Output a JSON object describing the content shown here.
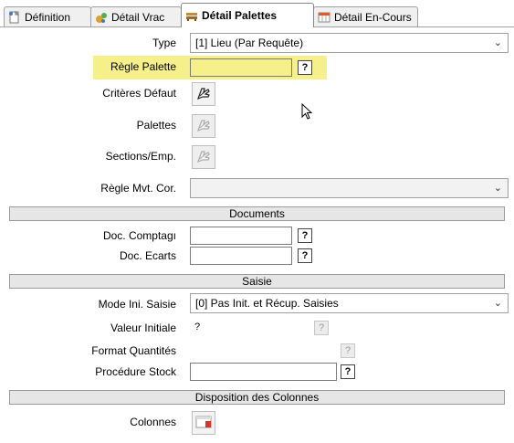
{
  "tabs": [
    {
      "label": "Définition",
      "icon": "document-icon"
    },
    {
      "label": "Détail Vrac",
      "icon": "bulk-icon"
    },
    {
      "label": "Détail Palettes",
      "icon": "pallet-icon",
      "active": true
    },
    {
      "label": "Détail En-Cours",
      "icon": "table-icon"
    }
  ],
  "form": {
    "type_label": "Type",
    "type_value": "[1] Lieu (Par Requête)",
    "regle_palette_label": "Règle Palette",
    "regle_palette_value": "",
    "criteres_defaut_label": "Critères Défaut",
    "palettes_label": "Palettes",
    "sections_label": "Sections/Emp.",
    "regle_mvt_label": "Règle Mvt. Cor.",
    "regle_mvt_value": "",
    "help_glyph": "?"
  },
  "documents": {
    "title": "Documents",
    "doc_comptage_label": "Doc. Comptagı",
    "doc_comptage_value": "",
    "doc_ecarts_label": "Doc. Ecarts",
    "doc_ecarts_value": ""
  },
  "saisie": {
    "title": "Saisie",
    "mode_label": "Mode Ini. Saisie",
    "mode_value": "[0] Pas Init. et Récup. Saisies",
    "valeur_label": "Valeur Initiale",
    "valeur_value": "?",
    "format_label": "Format Quantités",
    "procedure_label": "Procédure Stock",
    "procedure_value": ""
  },
  "disposition": {
    "title": "Disposition des Colonnes",
    "colonnes_label": "Colonnes"
  },
  "colors": {
    "highlight": "#f5f08a",
    "section_bg": "#e6e6e6",
    "tab_border": "#a0a0a0"
  }
}
